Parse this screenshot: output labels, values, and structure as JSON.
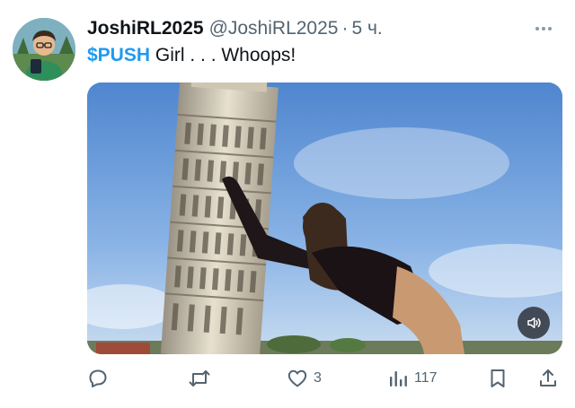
{
  "post": {
    "display_name": "JoshiRL2025",
    "handle": "@JoshiRL2025",
    "separator": "·",
    "time": "5 ч.",
    "cashtag": "$PUSH",
    "text": " Girl . . . Whoops!",
    "more_icon": "more-horizontal-icon"
  },
  "media": {
    "type": "video",
    "sound_icon": "volume-icon"
  },
  "actions": {
    "reply_icon": "reply-icon",
    "repost_icon": "repost-icon",
    "like_icon": "heart-icon",
    "like_count": "3",
    "views_icon": "views-chart-icon",
    "views_count": "117",
    "bookmark_icon": "bookmark-icon",
    "share_icon": "share-icon"
  },
  "colors": {
    "link": "#1d9bf0",
    "muted": "#536471",
    "text": "#0f1419"
  }
}
